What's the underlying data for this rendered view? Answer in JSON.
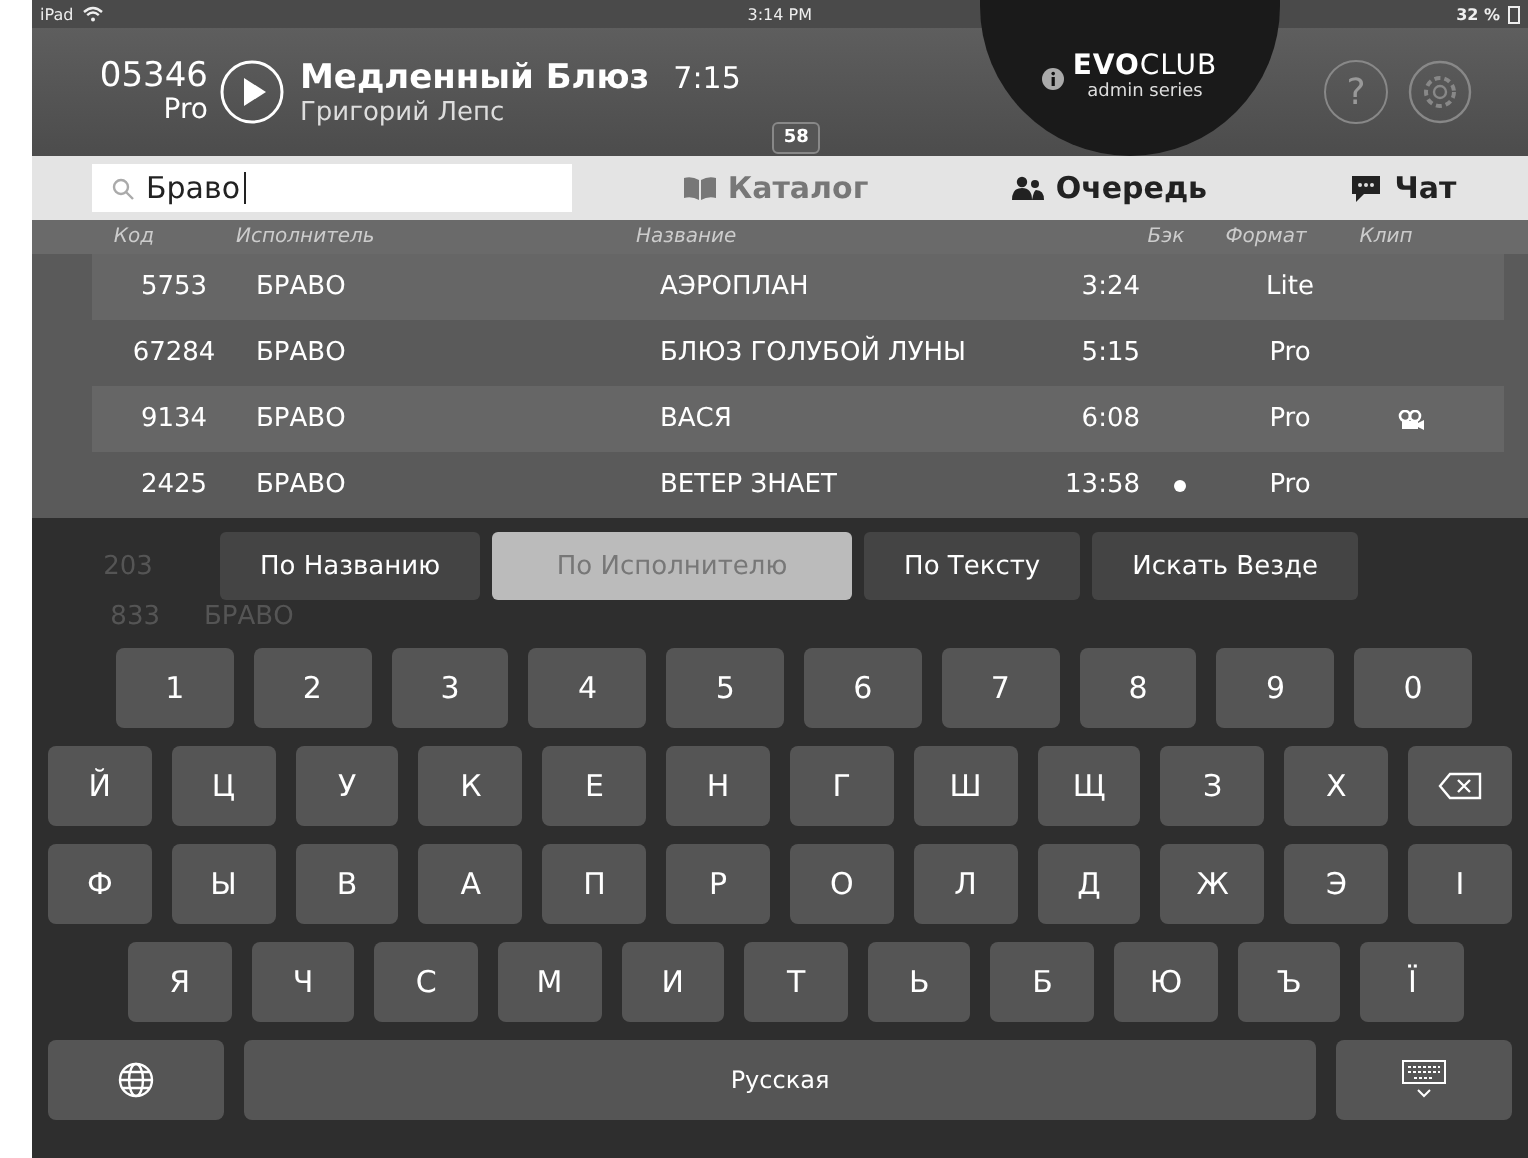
{
  "status_bar": {
    "device": "iPad",
    "time": "3:14 PM",
    "battery": "32 %"
  },
  "now_playing": {
    "code": "05346",
    "format": "Pro",
    "title": "Медленный Блюз",
    "duration": "7:15",
    "artist": "Григорий Лепс"
  },
  "logo": {
    "brand_bold": "EVO",
    "brand_light": "CLUB",
    "subtitle": "admin series"
  },
  "search": {
    "value": "Браво"
  },
  "tabs": [
    {
      "label": "Каталог",
      "selected": true,
      "badge": "58",
      "kind": "book"
    },
    {
      "label": "Очередь",
      "selected": false,
      "kind": "people"
    },
    {
      "label": "Чат",
      "selected": false,
      "kind": "chat"
    }
  ],
  "help_button": {
    "label": "?"
  },
  "table": {
    "columns": [
      "Код",
      "Исполнитель",
      "Название",
      "Бэк",
      "Формат",
      "Клип"
    ],
    "rows": [
      {
        "code": "5753",
        "artist": "БРАВО",
        "title": "АЭРОПЛАН",
        "duration": "3:24",
        "back": false,
        "format": "Lite",
        "clip": false
      },
      {
        "code": "67284",
        "artist": "БРАВО",
        "title": "БЛЮЗ ГОЛУБОЙ ЛУНЫ",
        "duration": "5:15",
        "back": false,
        "format": "Pro",
        "clip": false
      },
      {
        "code": "9134",
        "artist": "БРАВО",
        "title": "ВАСЯ",
        "duration": "6:08",
        "back": false,
        "format": "Pro",
        "clip": true
      },
      {
        "code": "2425",
        "artist": "БРАВО",
        "title": "ВЕТЕР ЗНАЕТ",
        "duration": "13:58",
        "back": true,
        "format": "Pro",
        "clip": false
      }
    ],
    "hidden_rows": [
      {
        "code": "203"
      },
      {
        "code": "833",
        "artist": "БРАВО"
      }
    ]
  },
  "search_filters": [
    {
      "label": "По Названию",
      "selected": false
    },
    {
      "label": "По Исполнителю",
      "selected": true
    },
    {
      "label": "По Тексту",
      "selected": false
    },
    {
      "label": "Искать Везде",
      "selected": false
    }
  ],
  "keyboard": {
    "rows": [
      [
        {
          "label": "1"
        },
        {
          "label": "2"
        },
        {
          "label": "3"
        },
        {
          "label": "4"
        },
        {
          "label": "5"
        },
        {
          "label": "6"
        },
        {
          "label": "7"
        },
        {
          "label": "8"
        },
        {
          "label": "9"
        },
        {
          "label": "0"
        }
      ],
      [
        {
          "label": "Й"
        },
        {
          "label": "Ц"
        },
        {
          "label": "У"
        },
        {
          "label": "К"
        },
        {
          "label": "Е"
        },
        {
          "label": "Н"
        },
        {
          "label": "Г"
        },
        {
          "label": "Ш"
        },
        {
          "label": "Щ"
        },
        {
          "label": "З"
        },
        {
          "label": "Х"
        },
        {
          "kind": "backspace"
        }
      ],
      [
        {
          "label": "Ф"
        },
        {
          "label": "Ы"
        },
        {
          "label": "В"
        },
        {
          "label": "А"
        },
        {
          "label": "П"
        },
        {
          "label": "Р"
        },
        {
          "label": "О"
        },
        {
          "label": "Л"
        },
        {
          "label": "Д"
        },
        {
          "label": "Ж"
        },
        {
          "label": "Э"
        },
        {
          "label": "І"
        }
      ],
      [
        {
          "label": "Я"
        },
        {
          "label": "Ч"
        },
        {
          "label": "С"
        },
        {
          "label": "М"
        },
        {
          "label": "И"
        },
        {
          "label": "Т"
        },
        {
          "label": "Ь"
        },
        {
          "label": "Б"
        },
        {
          "label": "Ю"
        },
        {
          "label": "Ъ"
        },
        {
          "label": "Ї"
        }
      ],
      [
        {
          "kind": "globe"
        },
        {
          "kind": "space",
          "label": "Русская"
        },
        {
          "kind": "hide"
        }
      ]
    ]
  }
}
